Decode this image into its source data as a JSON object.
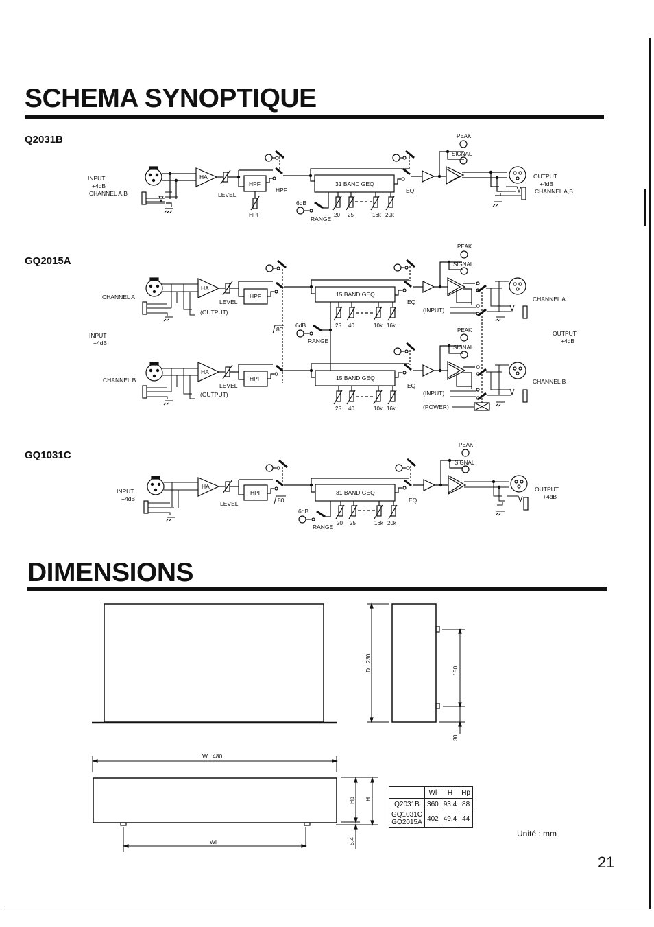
{
  "sections": {
    "schema_title": "SCHEMA SYNOPTIQUE",
    "dimensions_title": "DIMENSIONS"
  },
  "diagrams": {
    "q2031b": {
      "model": "Q2031B",
      "input": [
        "INPUT",
        "+4dB",
        "CHANNEL A,B"
      ],
      "ha": "HA",
      "level": "LEVEL",
      "hpf_box": "HPF",
      "hpf_switch": "HPF",
      "hpf_pot": "HPF",
      "geq": "31 BAND GEQ",
      "eq": "EQ",
      "range_db": "6dB",
      "range": "RANGE",
      "bands": [
        "20",
        "25",
        "16k",
        "20k"
      ],
      "peak": "PEAK",
      "signal": "SIGNAL",
      "output": [
        "OUTPUT",
        "+4dB",
        "CHANNEL A,B"
      ]
    },
    "gq2015a": {
      "model": "GQ2015A",
      "channel_a": "CHANNEL A",
      "channel_b": "CHANNEL B",
      "input": [
        "INPUT",
        "+4dB"
      ],
      "ha": "HA",
      "level": "LEVEL",
      "hpf_box": "HPF",
      "hpf_freq": "80",
      "output_tap": "(OUTPUT)",
      "geq": "15 BAND GEQ",
      "eq": "EQ",
      "range_db": "6dB",
      "range": "RANGE",
      "bands": [
        "25",
        "40",
        "10k",
        "16k"
      ],
      "peak": "PEAK",
      "signal": "SIGNAL",
      "input_tap": "(INPUT)",
      "power": "(POWER)",
      "output": [
        "OUTPUT",
        "+4dB"
      ]
    },
    "gq1031c": {
      "model": "GQ1031C",
      "input": [
        "INPUT",
        "+4dB"
      ],
      "ha": "HA",
      "level": "LEVEL",
      "hpf_box": "HPF",
      "hpf_freq": "80",
      "geq": "31 BAND GEQ",
      "eq": "EQ",
      "range_db": "6dB",
      "range": "RANGE",
      "bands": [
        "20",
        "25",
        "16k",
        "20k"
      ],
      "peak": "PEAK",
      "signal": "SIGNAL",
      "output": [
        "OUTPUT",
        "+4dB"
      ]
    }
  },
  "dimensions": {
    "depth": "D : 230",
    "rack_spacing": "150",
    "rear_offset": "30",
    "width": "W : 480",
    "wl": "Wl",
    "hp": "Hp",
    "h": "H",
    "foot": "5,4",
    "table": {
      "headers": [
        "",
        "Wl",
        "H",
        "Hp"
      ],
      "rows": [
        {
          "models": [
            "Q2031B"
          ],
          "wl": "360",
          "h": "93.4",
          "hp": "88"
        },
        {
          "models": [
            "GQ1031C",
            "GQ2015A"
          ],
          "wl": "402",
          "h": "49.4",
          "hp": "44"
        }
      ]
    },
    "unit": "Unité : mm"
  },
  "page_number": "21"
}
